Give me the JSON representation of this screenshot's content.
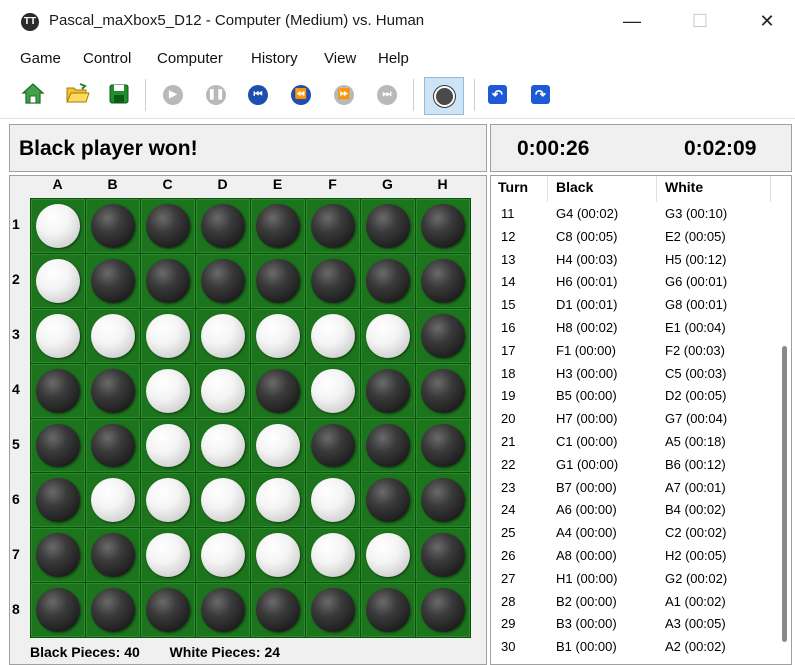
{
  "window": {
    "title": "Pascal_maXbox5_D12 - Computer (Medium) vs. Human",
    "minimize_symbol": "—",
    "maximize_symbol": "☐",
    "close_symbol": "✕"
  },
  "menu": [
    "Game",
    "Control",
    "Computer",
    "History",
    "View",
    "Help"
  ],
  "toolbar": {
    "icons": [
      "home-icon",
      "open-folder-icon",
      "save-icon",
      "play-icon",
      "pause-icon",
      "first-icon",
      "rewind-icon",
      "forward-icon",
      "last-icon",
      "network-icon",
      "undo-icon",
      "redo-icon"
    ]
  },
  "status": {
    "message": "Black player won!"
  },
  "clocks": {
    "black": "0:00:26",
    "white": "0:02:09"
  },
  "board": {
    "columns": [
      "A",
      "B",
      "C",
      "D",
      "E",
      "F",
      "G",
      "H"
    ],
    "rows": [
      "1",
      "2",
      "3",
      "4",
      "5",
      "6",
      "7",
      "8"
    ],
    "cells": [
      [
        "W",
        "B",
        "B",
        "B",
        "B",
        "B",
        "B",
        "B"
      ],
      [
        "W",
        "B",
        "B",
        "B",
        "B",
        "B",
        "B",
        "B"
      ],
      [
        "W",
        "W",
        "W",
        "W",
        "W",
        "W",
        "W",
        "B"
      ],
      [
        "B",
        "B",
        "W",
        "W",
        "B",
        "W",
        "B",
        "B"
      ],
      [
        "B",
        "B",
        "W",
        "W",
        "W",
        "B",
        "B",
        "B"
      ],
      [
        "B",
        "W",
        "W",
        "W",
        "W",
        "W",
        "B",
        "B"
      ],
      [
        "B",
        "B",
        "W",
        "W",
        "W",
        "W",
        "W",
        "B"
      ],
      [
        "B",
        "B",
        "B",
        "B",
        "B",
        "B",
        "B",
        "B"
      ]
    ],
    "colors": {
      "board": "#1c741c",
      "black": "#1e1e1e",
      "white": "#f4f4f4"
    }
  },
  "pieces": {
    "black_label": "Black Pieces:",
    "black_count": "40",
    "white_label": "White Pieces:",
    "white_count": "24"
  },
  "history": {
    "headers": {
      "turn": "Turn",
      "black": "Black",
      "white": "White"
    },
    "rows": [
      {
        "turn": "11",
        "black": "G4  (00:02)",
        "white": "G3  (00:10)"
      },
      {
        "turn": "12",
        "black": "C8  (00:05)",
        "white": "E2  (00:05)"
      },
      {
        "turn": "13",
        "black": "H4  (00:03)",
        "white": "H5  (00:12)"
      },
      {
        "turn": "14",
        "black": "H6  (00:01)",
        "white": "G6  (00:01)"
      },
      {
        "turn": "15",
        "black": "D1  (00:01)",
        "white": "G8  (00:01)"
      },
      {
        "turn": "16",
        "black": "H8  (00:02)",
        "white": "E1  (00:04)"
      },
      {
        "turn": "17",
        "black": "F1  (00:00)",
        "white": "F2  (00:03)"
      },
      {
        "turn": "18",
        "black": "H3  (00:00)",
        "white": "C5  (00:03)"
      },
      {
        "turn": "19",
        "black": "B5  (00:00)",
        "white": "D2  (00:05)"
      },
      {
        "turn": "20",
        "black": "H7  (00:00)",
        "white": "G7  (00:04)"
      },
      {
        "turn": "21",
        "black": "C1  (00:00)",
        "white": "A5  (00:18)"
      },
      {
        "turn": "22",
        "black": "G1  (00:00)",
        "white": "B6  (00:12)"
      },
      {
        "turn": "23",
        "black": "B7  (00:00)",
        "white": "A7  (00:01)"
      },
      {
        "turn": "24",
        "black": "A6  (00:00)",
        "white": "B4  (00:02)"
      },
      {
        "turn": "25",
        "black": "A4  (00:00)",
        "white": "C2  (00:02)"
      },
      {
        "turn": "26",
        "black": "A8  (00:00)",
        "white": "H2  (00:05)"
      },
      {
        "turn": "27",
        "black": "H1  (00:00)",
        "white": "G2  (00:02)"
      },
      {
        "turn": "28",
        "black": "B2  (00:00)",
        "white": "A1  (00:02)"
      },
      {
        "turn": "29",
        "black": "B3  (00:00)",
        "white": "A3  (00:05)"
      },
      {
        "turn": "30",
        "black": "B1  (00:00)",
        "white": "A2  (00:02)"
      }
    ]
  }
}
